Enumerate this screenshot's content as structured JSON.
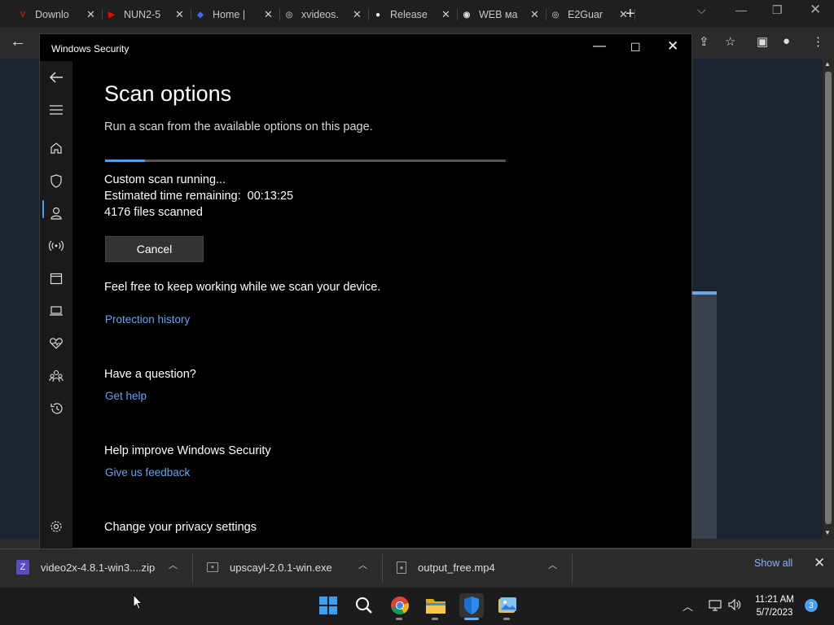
{
  "browser": {
    "tabs": [
      {
        "title": "Downlo",
        "favicon": "vivaldi-v-icon",
        "color": "#c4161c"
      },
      {
        "title": "NUN2-5",
        "favicon": "youtube-icon",
        "color": "#ff0000"
      },
      {
        "title": "Home |",
        "favicon": "diamond-icon",
        "color": "#3d6fe0"
      },
      {
        "title": "xvideos.",
        "favicon": "globe-icon",
        "color": "#9a9a9a"
      },
      {
        "title": "Release",
        "favicon": "github-icon",
        "color": "#ffffff"
      },
      {
        "title": "WEB ма",
        "favicon": "eye-icon",
        "color": "#dddddd"
      },
      {
        "title": "E2Guar",
        "favicon": "globe-icon",
        "color": "#9a9a9a"
      }
    ]
  },
  "window": {
    "title": "Windows Security"
  },
  "nav": {
    "items": [
      "back-arrow-icon",
      "hamburger-menu-icon",
      "home-icon",
      "shield-icon",
      "account-icon",
      "network-icon",
      "app-browser-icon",
      "device-security-icon",
      "health-heart-icon",
      "family-icon",
      "history-icon",
      "settings-gear-icon"
    ],
    "active_index": 3,
    "accent": "#4aa0f0"
  },
  "main": {
    "title": "Scan options",
    "subtitle": "Run a scan from the available options on this page.",
    "progress": 0.1,
    "status_line": "Custom scan running...",
    "time_label": "Estimated time remaining:",
    "time_value": "00:13:25",
    "files_scanned": "4176 files scanned",
    "cancel_label": "Cancel",
    "keep_working_text": "Feel free to keep working while we scan your device.",
    "protection_history_link": "Protection history",
    "question_heading": "Have a question?",
    "get_help_link": "Get help",
    "improve_heading": "Help improve Windows Security",
    "feedback_link": "Give us feedback",
    "privacy_heading": "Change your privacy settings",
    "link_color": "#5ea6ef"
  },
  "downloads": {
    "items": [
      {
        "name": "video2x-4.8.1-win3....zip",
        "icon": "zip-archive-icon"
      },
      {
        "name": "upscayl-2.0.1-win.exe",
        "icon": "exe-file-icon"
      },
      {
        "name": "output_free.mp4",
        "icon": "video-file-icon"
      }
    ],
    "show_all_label": "Show all"
  },
  "taskbar": {
    "apps": [
      "windows-start-icon",
      "search-icon",
      "chrome-icon",
      "file-explorer-icon",
      "windows-security-icon",
      "photos-icon"
    ],
    "time": "11:21 AM",
    "date": "5/7/2023",
    "notification_count": "3"
  }
}
